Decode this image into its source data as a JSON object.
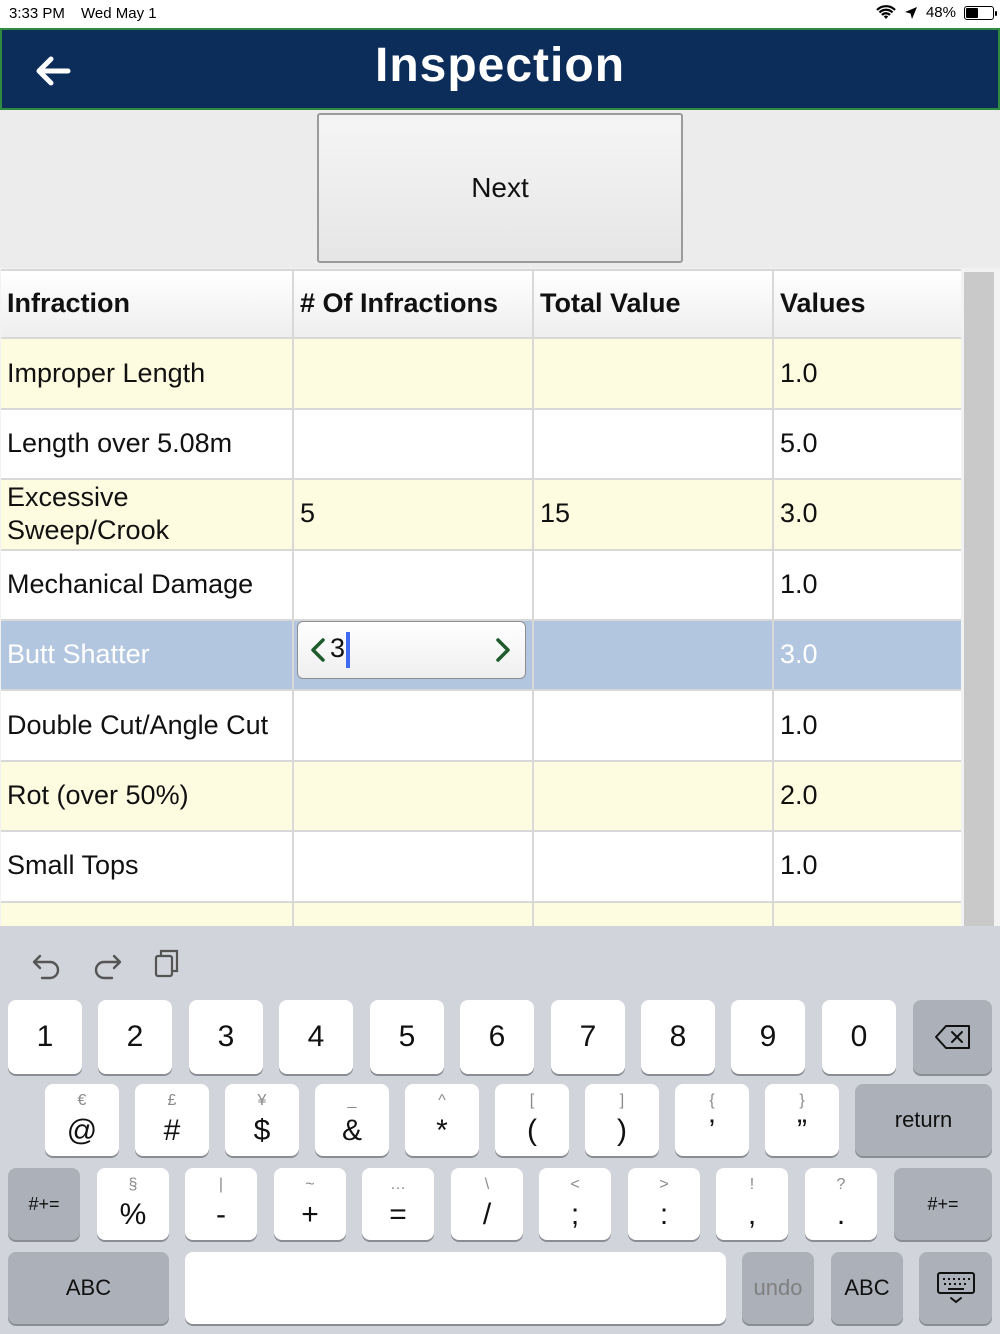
{
  "status": {
    "time": "3:33 PM",
    "date": "Wed May 1",
    "battery": "48%",
    "battery_level": 0.48
  },
  "header": {
    "title": "Inspection",
    "back_icon": "arrow-left-icon"
  },
  "next_button": {
    "label": "Next"
  },
  "table": {
    "columns": [
      "Infraction",
      "# Of Infractions",
      "Total Value",
      "Values"
    ],
    "rows": [
      {
        "infraction": "Improper Length",
        "count": "",
        "total": "",
        "value": "1.0"
      },
      {
        "infraction": "Length over 5.08m",
        "count": "",
        "total": "",
        "value": "5.0"
      },
      {
        "infraction": "Excessive Sweep/Crook",
        "count": "5",
        "total": "15",
        "value": "3.0"
      },
      {
        "infraction": "Mechanical Damage",
        "count": "",
        "total": "",
        "value": "1.0"
      },
      {
        "infraction": "Butt Shatter",
        "count": "3",
        "total": "",
        "value": "3.0"
      },
      {
        "infraction": "Double Cut/Angle Cut",
        "count": "",
        "total": "",
        "value": "1.0"
      },
      {
        "infraction": "Rot (over 50%)",
        "count": "",
        "total": "",
        "value": "2.0"
      },
      {
        "infraction": "Small Tops",
        "count": "",
        "total": "",
        "value": "1.0"
      },
      {
        "infraction": "",
        "count": "",
        "total": "",
        "value": ""
      }
    ],
    "selected_row": 4
  },
  "keyboard": {
    "row1": [
      "1",
      "2",
      "3",
      "4",
      "5",
      "6",
      "7",
      "8",
      "9",
      "0"
    ],
    "row2": [
      {
        "main": "@",
        "alt": "€"
      },
      {
        "main": "#",
        "alt": "£"
      },
      {
        "main": "$",
        "alt": "¥"
      },
      {
        "main": "&",
        "alt": "_"
      },
      {
        "main": "*",
        "alt": "^"
      },
      {
        "main": "(",
        "alt": "["
      },
      {
        "main": ")",
        "alt": "]"
      },
      {
        "main": "’",
        "alt": "{"
      },
      {
        "main": "”",
        "alt": "}"
      }
    ],
    "return_label": "return",
    "row3": [
      {
        "main": "%",
        "alt": "§"
      },
      {
        "main": "-",
        "alt": "|"
      },
      {
        "main": "+",
        "alt": "~"
      },
      {
        "main": "=",
        "alt": "…"
      },
      {
        "main": "/",
        "alt": "\\"
      },
      {
        "main": ";",
        "alt": "<"
      },
      {
        "main": ":",
        "alt": ">"
      },
      {
        "main": ",",
        "alt": "!"
      },
      {
        "main": ".",
        "alt": "?"
      }
    ],
    "symbols_label": "#+=",
    "abc_label": "ABC",
    "undo_label": "undo"
  }
}
